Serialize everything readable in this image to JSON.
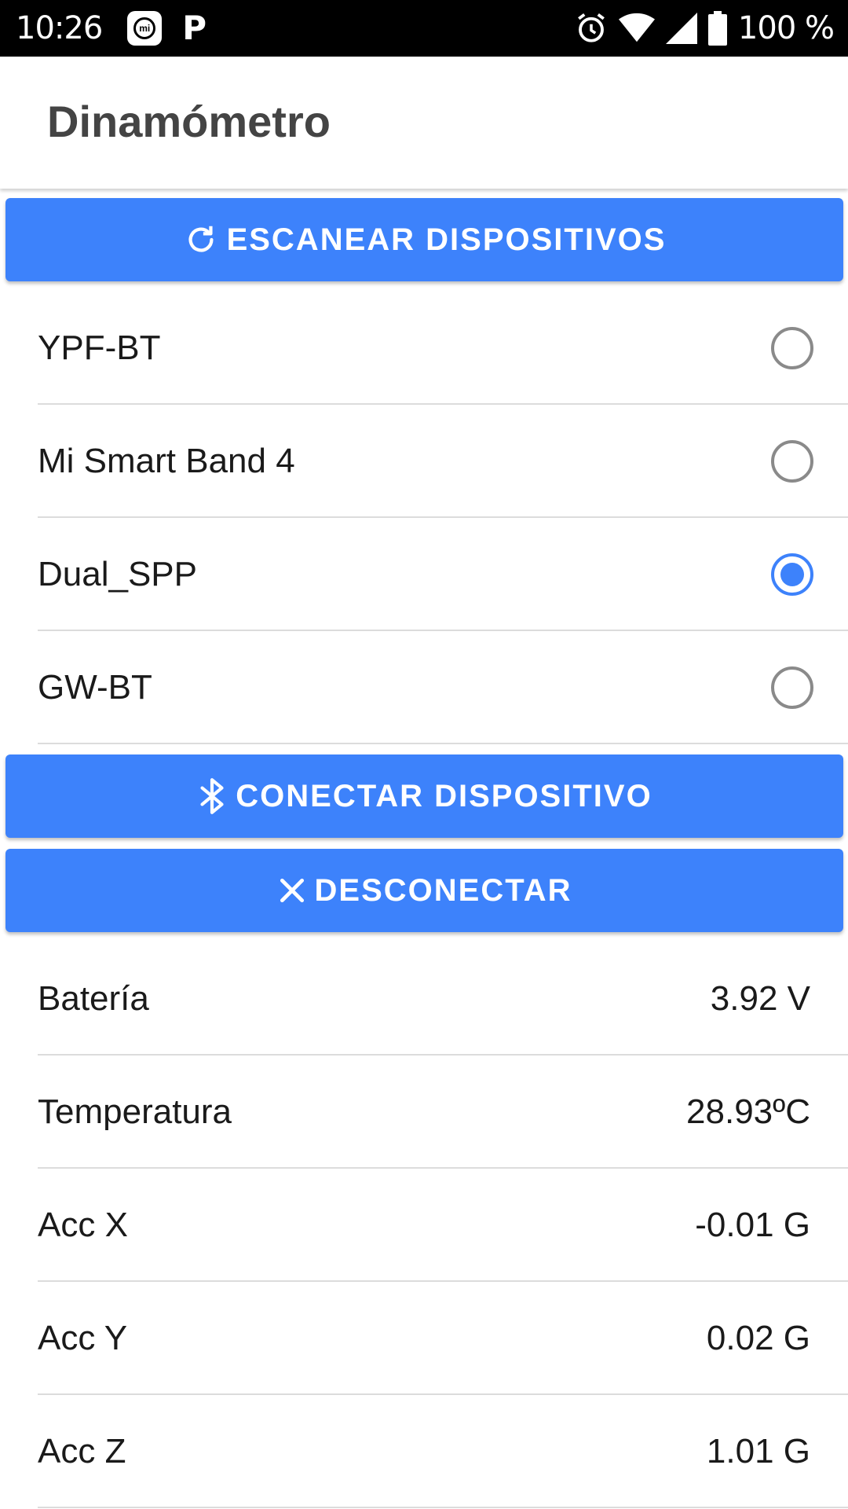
{
  "status_bar": {
    "time": "10:26",
    "battery": "100 %",
    "icons": [
      "mi-app-icon",
      "p-app-icon",
      "alarm-icon",
      "wifi-icon",
      "signal-icon",
      "battery-icon"
    ]
  },
  "app_bar": {
    "title": "Dinamómetro"
  },
  "buttons": {
    "scan": {
      "label": "ESCANEAR DISPOSITIVOS",
      "icon": "refresh-icon"
    },
    "connect": {
      "label": "CONECTAR DISPOSITIVO",
      "icon": "bluetooth-icon"
    },
    "disconnect": {
      "label": "DESCONECTAR",
      "icon": "close-icon"
    }
  },
  "devices": [
    {
      "name": "YPF-BT",
      "selected": false
    },
    {
      "name": "Mi Smart Band 4",
      "selected": false
    },
    {
      "name": "Dual_SPP",
      "selected": true
    },
    {
      "name": "GW-BT",
      "selected": false
    }
  ],
  "readings": [
    {
      "label": "Batería",
      "value": "3.92 V"
    },
    {
      "label": "Temperatura",
      "value": "28.93ºC"
    },
    {
      "label": "Acc X",
      "value": "-0.01 G"
    },
    {
      "label": "Acc Y",
      "value": "0.02 G"
    },
    {
      "label": "Acc Z",
      "value": "1.01 G"
    }
  ],
  "colors": {
    "accent": "#3d82fb",
    "radio_off": "#8a8a8a",
    "divider": "#dcdcdc"
  }
}
